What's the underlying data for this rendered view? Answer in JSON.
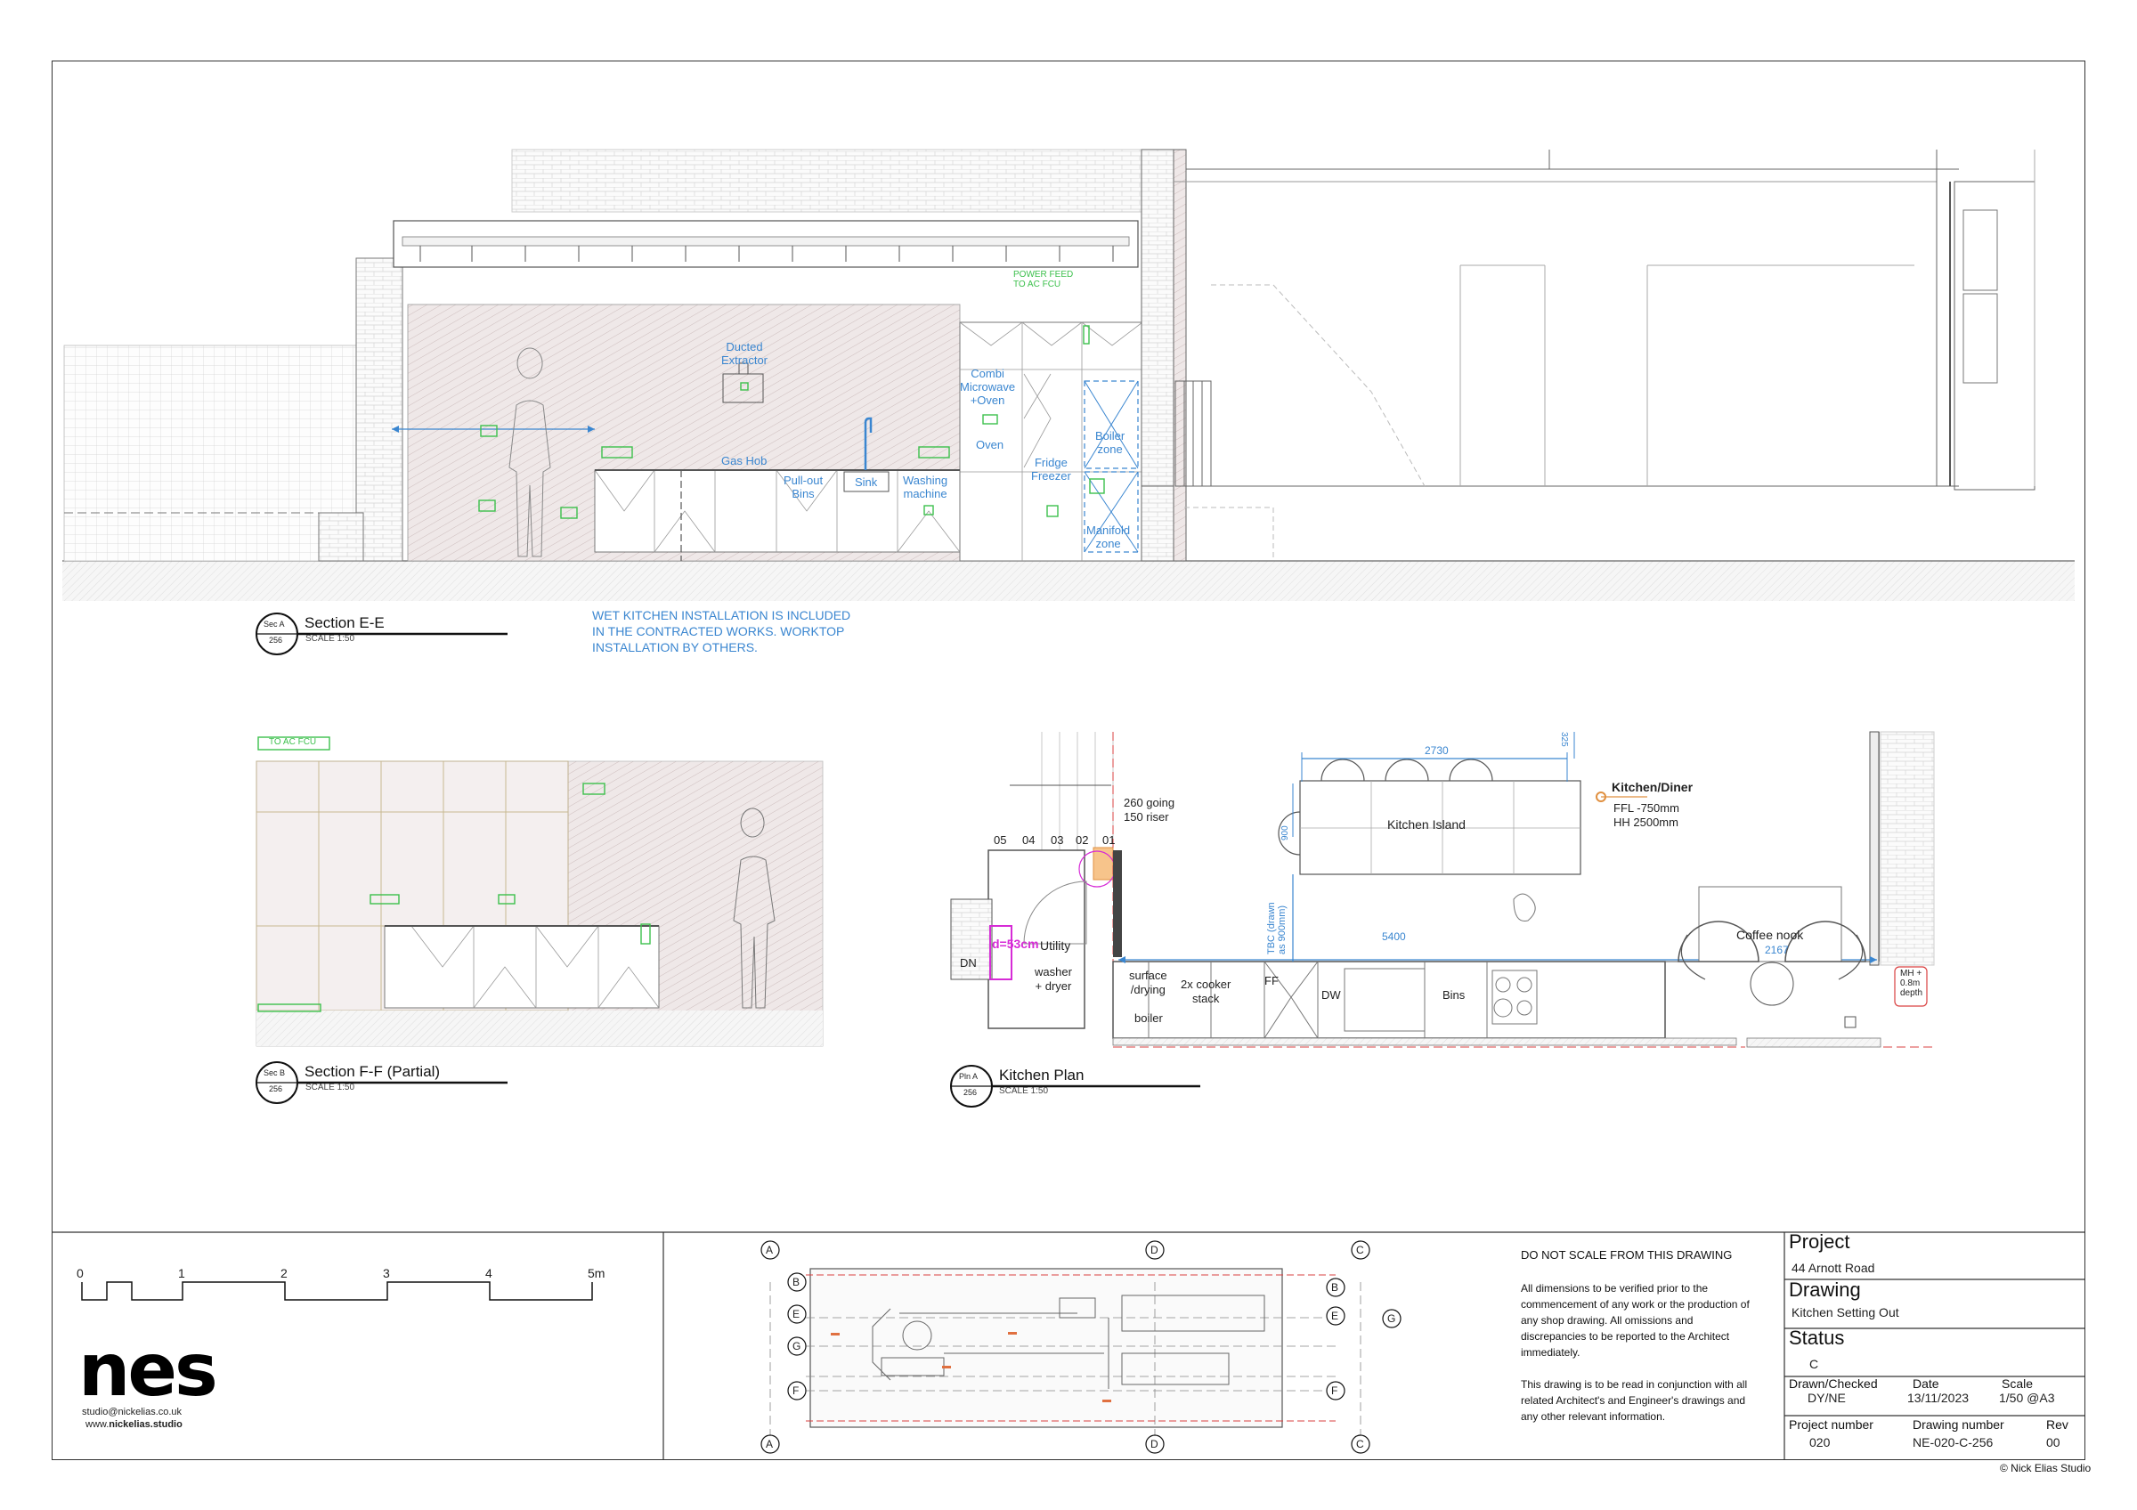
{
  "colors": {
    "line": "#555555",
    "hatch": "#c9b8b8",
    "blue": "#3a86d0",
    "green": "#3cc04c",
    "magenta": "#d62bd6",
    "orange": "#f0a050",
    "red": "#d94040"
  },
  "section_ee": {
    "marker_top": "Sec A",
    "marker_bottom": "256",
    "title": "Section E-E",
    "scale": "SCALE 1:50",
    "labels": {
      "power_feed": "POWER FEED\nTO AC FCU",
      "ducted_extractor": "Ducted\nExtractor",
      "gas_hob": "Gas Hob",
      "pullout_bins": "Pull-out\nBins",
      "sink": "Sink",
      "washing_machine": "Washing\nmachine",
      "combi_microwave": "Combi\nMicrowave\n+Oven",
      "oven": "Oven",
      "fridge_freezer": "Fridge\nFreezer",
      "boiler_zone": "Boiler\nzone",
      "manifold_zone": "Manifold\nzone"
    }
  },
  "wet_note": [
    "WET KITCHEN INSTALLATION IS INCLUDED",
    "IN THE CONTRACTED WORKS. WORKTOP",
    "INSTALLATION BY OTHERS."
  ],
  "section_ff": {
    "marker_top": "Sec B",
    "marker_bottom": "256",
    "title": "Section F-F (Partial)",
    "scale": "SCALE 1:50",
    "labels": {
      "power_feed": "TO AC FCU"
    }
  },
  "kitchen_plan": {
    "marker_top": "Pln A",
    "marker_bottom": "256",
    "title": "Kitchen Plan",
    "scale": "SCALE 1:50",
    "labels": {
      "stairs_going": "260 going",
      "stairs_riser": "150 riser",
      "step_numbers": [
        "05",
        "04",
        "03",
        "02",
        "01"
      ],
      "dim_2730": "2730",
      "dim_325": "325",
      "dim_900": "900",
      "kitchen_island": "Kitchen Island",
      "kitchen_diner": "Kitchen/Diner",
      "ffl": "FFL -750mm",
      "hh": "HH 2500mm",
      "tbc": "TBC (drawn\nas 900mm)",
      "dim_5400": "5400",
      "dim_2167": "2167",
      "coffee_nook": "Coffee nook",
      "utility": "Utility",
      "d53": "d=53cm",
      "dn": "DN",
      "washer_dryer": "washer\n+ dryer",
      "surface_drying": "surface\n/drying",
      "boiler": "boiler",
      "cooker_stack": "2x cooker\nstack",
      "ff": "FF",
      "dw": "DW",
      "bins": "Bins",
      "mh": "MH +\n0.8m\ndepth"
    }
  },
  "scale_bar": {
    "ticks": [
      "0",
      "1",
      "2",
      "3",
      "4",
      "5m"
    ]
  },
  "logo": {
    "mark": "nes",
    "email": "studio@nickelias.co.uk",
    "web_prefix": "www.",
    "web_bold": "nickelias.studio"
  },
  "key_plan": {
    "grid_letters": [
      "A",
      "B",
      "E",
      "G",
      "F",
      "D",
      "C"
    ]
  },
  "notes": {
    "heading": "DO NOT SCALE FROM THIS DRAWING",
    "para1": "All dimensions to be verified prior to the commencement of any work or the production of any shop drawing. All omissions and discrepancies to be reported to the Architect immediately.",
    "para2": "This drawing is to be read in conjunction with all related Architect's and Engineer's drawings and any other relevant information."
  },
  "title_block": {
    "project_label": "Project",
    "project_value": "44 Arnott Road",
    "drawing_label": "Drawing",
    "drawing_value": "Kitchen Setting Out",
    "status_label": "Status",
    "status_value": "C",
    "drawn_label": "Drawn/Checked",
    "drawn_value": "DY/NE",
    "date_label": "Date",
    "date_value": "13/11/2023",
    "scale_label": "Scale",
    "scale_value": "1/50 @A3",
    "projnum_label": "Project number",
    "projnum_value": "020",
    "drawnum_label": "Drawing number",
    "drawnum_value": "NE-020-C-256",
    "rev_label": "Rev",
    "rev_value": "00"
  },
  "copyright": "© Nick Elias Studio"
}
